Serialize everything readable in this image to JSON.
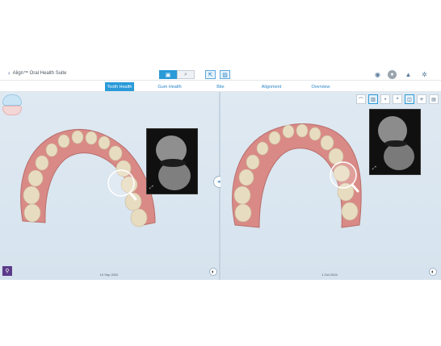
{
  "header": {
    "app_title": "Align™ Oral Health Suite",
    "back_chevron": "‹",
    "center_buttons": [
      {
        "icon": "folder-icon",
        "glyph": "▣"
      },
      {
        "icon": "search-icon",
        "glyph": "⌕"
      }
    ],
    "right_buttons": [
      {
        "icon": "export-icon",
        "glyph": "⇱"
      },
      {
        "icon": "image-icon",
        "glyph": "▨"
      }
    ],
    "util_icons": [
      {
        "icon": "camera-icon",
        "glyph": "◉"
      },
      {
        "icon": "user-avatar-icon",
        "glyph": "●"
      },
      {
        "icon": "graduation-cap-icon",
        "glyph": "▲"
      },
      {
        "icon": "settings-gear-icon",
        "glyph": "✲"
      }
    ]
  },
  "tabs": [
    {
      "label": "Tooth Health",
      "active": true
    },
    {
      "label": "Gum Health",
      "active": false
    },
    {
      "label": "Bite",
      "active": false
    },
    {
      "label": "Alignment",
      "active": false
    },
    {
      "label": "Overview",
      "active": false
    }
  ],
  "left_view": {
    "date": "10 Sep 2022",
    "expand_glyph": "⤢",
    "contrast_glyph": "◐",
    "tools_glyph": "⚲"
  },
  "right_view": {
    "date": "1 Oct 2024",
    "expand_glyph": "⤢",
    "contrast_glyph": "◐",
    "tools": [
      {
        "icon": "jaw-upper-icon",
        "glyph": "⌒"
      },
      {
        "icon": "jaw-teeth-icon",
        "glyph": "▥",
        "selected": true
      },
      {
        "icon": "occlusion-icon",
        "glyph": "◒"
      },
      {
        "icon": "bite-icon",
        "glyph": "◓"
      },
      {
        "icon": "compare-icon",
        "glyph": "◫",
        "selected": true
      },
      {
        "icon": "loading-icon",
        "glyph": "✳"
      },
      {
        "icon": "report-icon",
        "glyph": "▤"
      }
    ]
  },
  "link_glyph": "⚭",
  "colors": {
    "accent": "#2a9ad8",
    "viewport_bg": "#dce7f1",
    "gum": "#d98a86",
    "tooth": "#e8dcc0"
  }
}
